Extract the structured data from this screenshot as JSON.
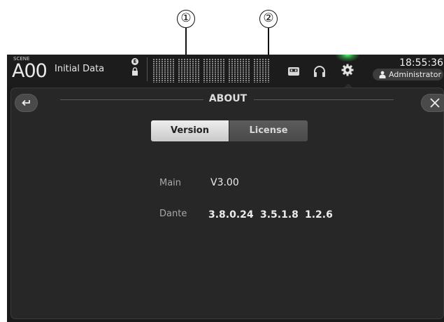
{
  "callouts": [
    "①",
    "②"
  ],
  "topbar": {
    "scene_tag": "SCENE",
    "scene_number": "A00",
    "scene_name": "Initial Data",
    "e_badge": "E",
    "clock": "18:55:36",
    "user": "Administrator",
    "icons": [
      "lock-icon",
      "recorder-icon",
      "headphones-icon",
      "gear-icon",
      "person-icon"
    ],
    "accent_color": "#4cff6a"
  },
  "dialog": {
    "title": "ABOUT",
    "tabs": [
      {
        "label": "Version",
        "selected": true
      },
      {
        "label": "License",
        "selected": false
      }
    ],
    "rows": [
      {
        "label": "Main",
        "values": [
          "V3.00"
        ]
      },
      {
        "label": "Dante",
        "values": [
          "3.8.0.24",
          "3.5.1.8",
          "1.2.6"
        ]
      }
    ],
    "icons": [
      "back-icon",
      "close-icon"
    ]
  }
}
